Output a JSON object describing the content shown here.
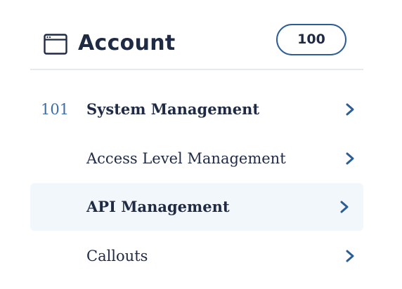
{
  "header": {
    "icon": "window-icon",
    "title": "Account",
    "count": "100"
  },
  "items": [
    {
      "number": "101",
      "label": "System Management",
      "bold": true,
      "active": false,
      "icon": "chevron-right-icon"
    },
    {
      "number": "",
      "label": "Access Level Management",
      "bold": false,
      "active": false,
      "icon": "chevron-right-icon"
    },
    {
      "number": "",
      "label": "API Management",
      "bold": true,
      "active": true,
      "icon": "chevron-right-icon"
    },
    {
      "number": "",
      "label": "Callouts",
      "bold": false,
      "active": false,
      "icon": "chevron-right-icon"
    }
  ],
  "colors": {
    "text": "#1f2a44",
    "accent": "#2b5d97",
    "active_background": "#f2f7fc",
    "divider": "#e6e9ee"
  }
}
